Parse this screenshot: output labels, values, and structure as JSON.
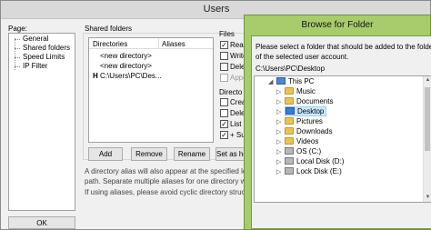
{
  "users_window": {
    "title": "Users",
    "page_label": "Page:",
    "pages": [
      "General",
      "Shared folders",
      "Speed Limits",
      "IP Filter"
    ],
    "shared_folders_label": "Shared folders",
    "table_headers": [
      "Directories",
      "Aliases"
    ],
    "rows": [
      "<new directory>",
      "<new directory>",
      "C:\\Users\\PC\\Des..."
    ],
    "home_marker": "H",
    "buttons": {
      "add": "Add",
      "remove": "Remove",
      "rename": "Rename",
      "set_home": "Set as ho"
    },
    "ok": "OK",
    "info_line1": "A directory alias will also appear at the specified location. Al",
    "info_line2": "path. Separate multiple aliases for one directory with the pip",
    "info_line3": "If using aliases, please avoid cyclic directory structures, it will",
    "files_label": "Files",
    "files_options": [
      "Read",
      "Write",
      "Delet",
      "Appe"
    ],
    "directories_label": "Directo",
    "dir_options": [
      "Create",
      "Delet",
      "List",
      "+ Sub"
    ]
  },
  "dialog": {
    "title": "Browse for Folder",
    "instructions_line1": "Please select a folder that should be added to the folders list",
    "instructions_line2": "of the selected user account.",
    "path": "C:\\Users\\PC\\Desktop",
    "tree": [
      {
        "label": "This PC",
        "icon": "computer-icon"
      },
      {
        "label": "Music",
        "icon": "music-folder-icon"
      },
      {
        "label": "Documents",
        "icon": "documents-folder-icon"
      },
      {
        "label": "Desktop",
        "icon": "desktop-folder-icon",
        "selected": true
      },
      {
        "label": "Pictures",
        "icon": "pictures-folder-icon"
      },
      {
        "label": "Downloads",
        "icon": "downloads-folder-icon"
      },
      {
        "label": "Videos",
        "icon": "videos-folder-icon"
      },
      {
        "label": "OS (C:)",
        "icon": "drive-icon"
      },
      {
        "label": "Local Disk (D:)",
        "icon": "drive-icon"
      },
      {
        "label": "Lock Disk (E:)",
        "icon": "drive-icon"
      }
    ]
  },
  "colors": {
    "dialog_frame": "#a8cc6c",
    "selection": "#cce8ff",
    "selection_border": "#99d1ff"
  }
}
